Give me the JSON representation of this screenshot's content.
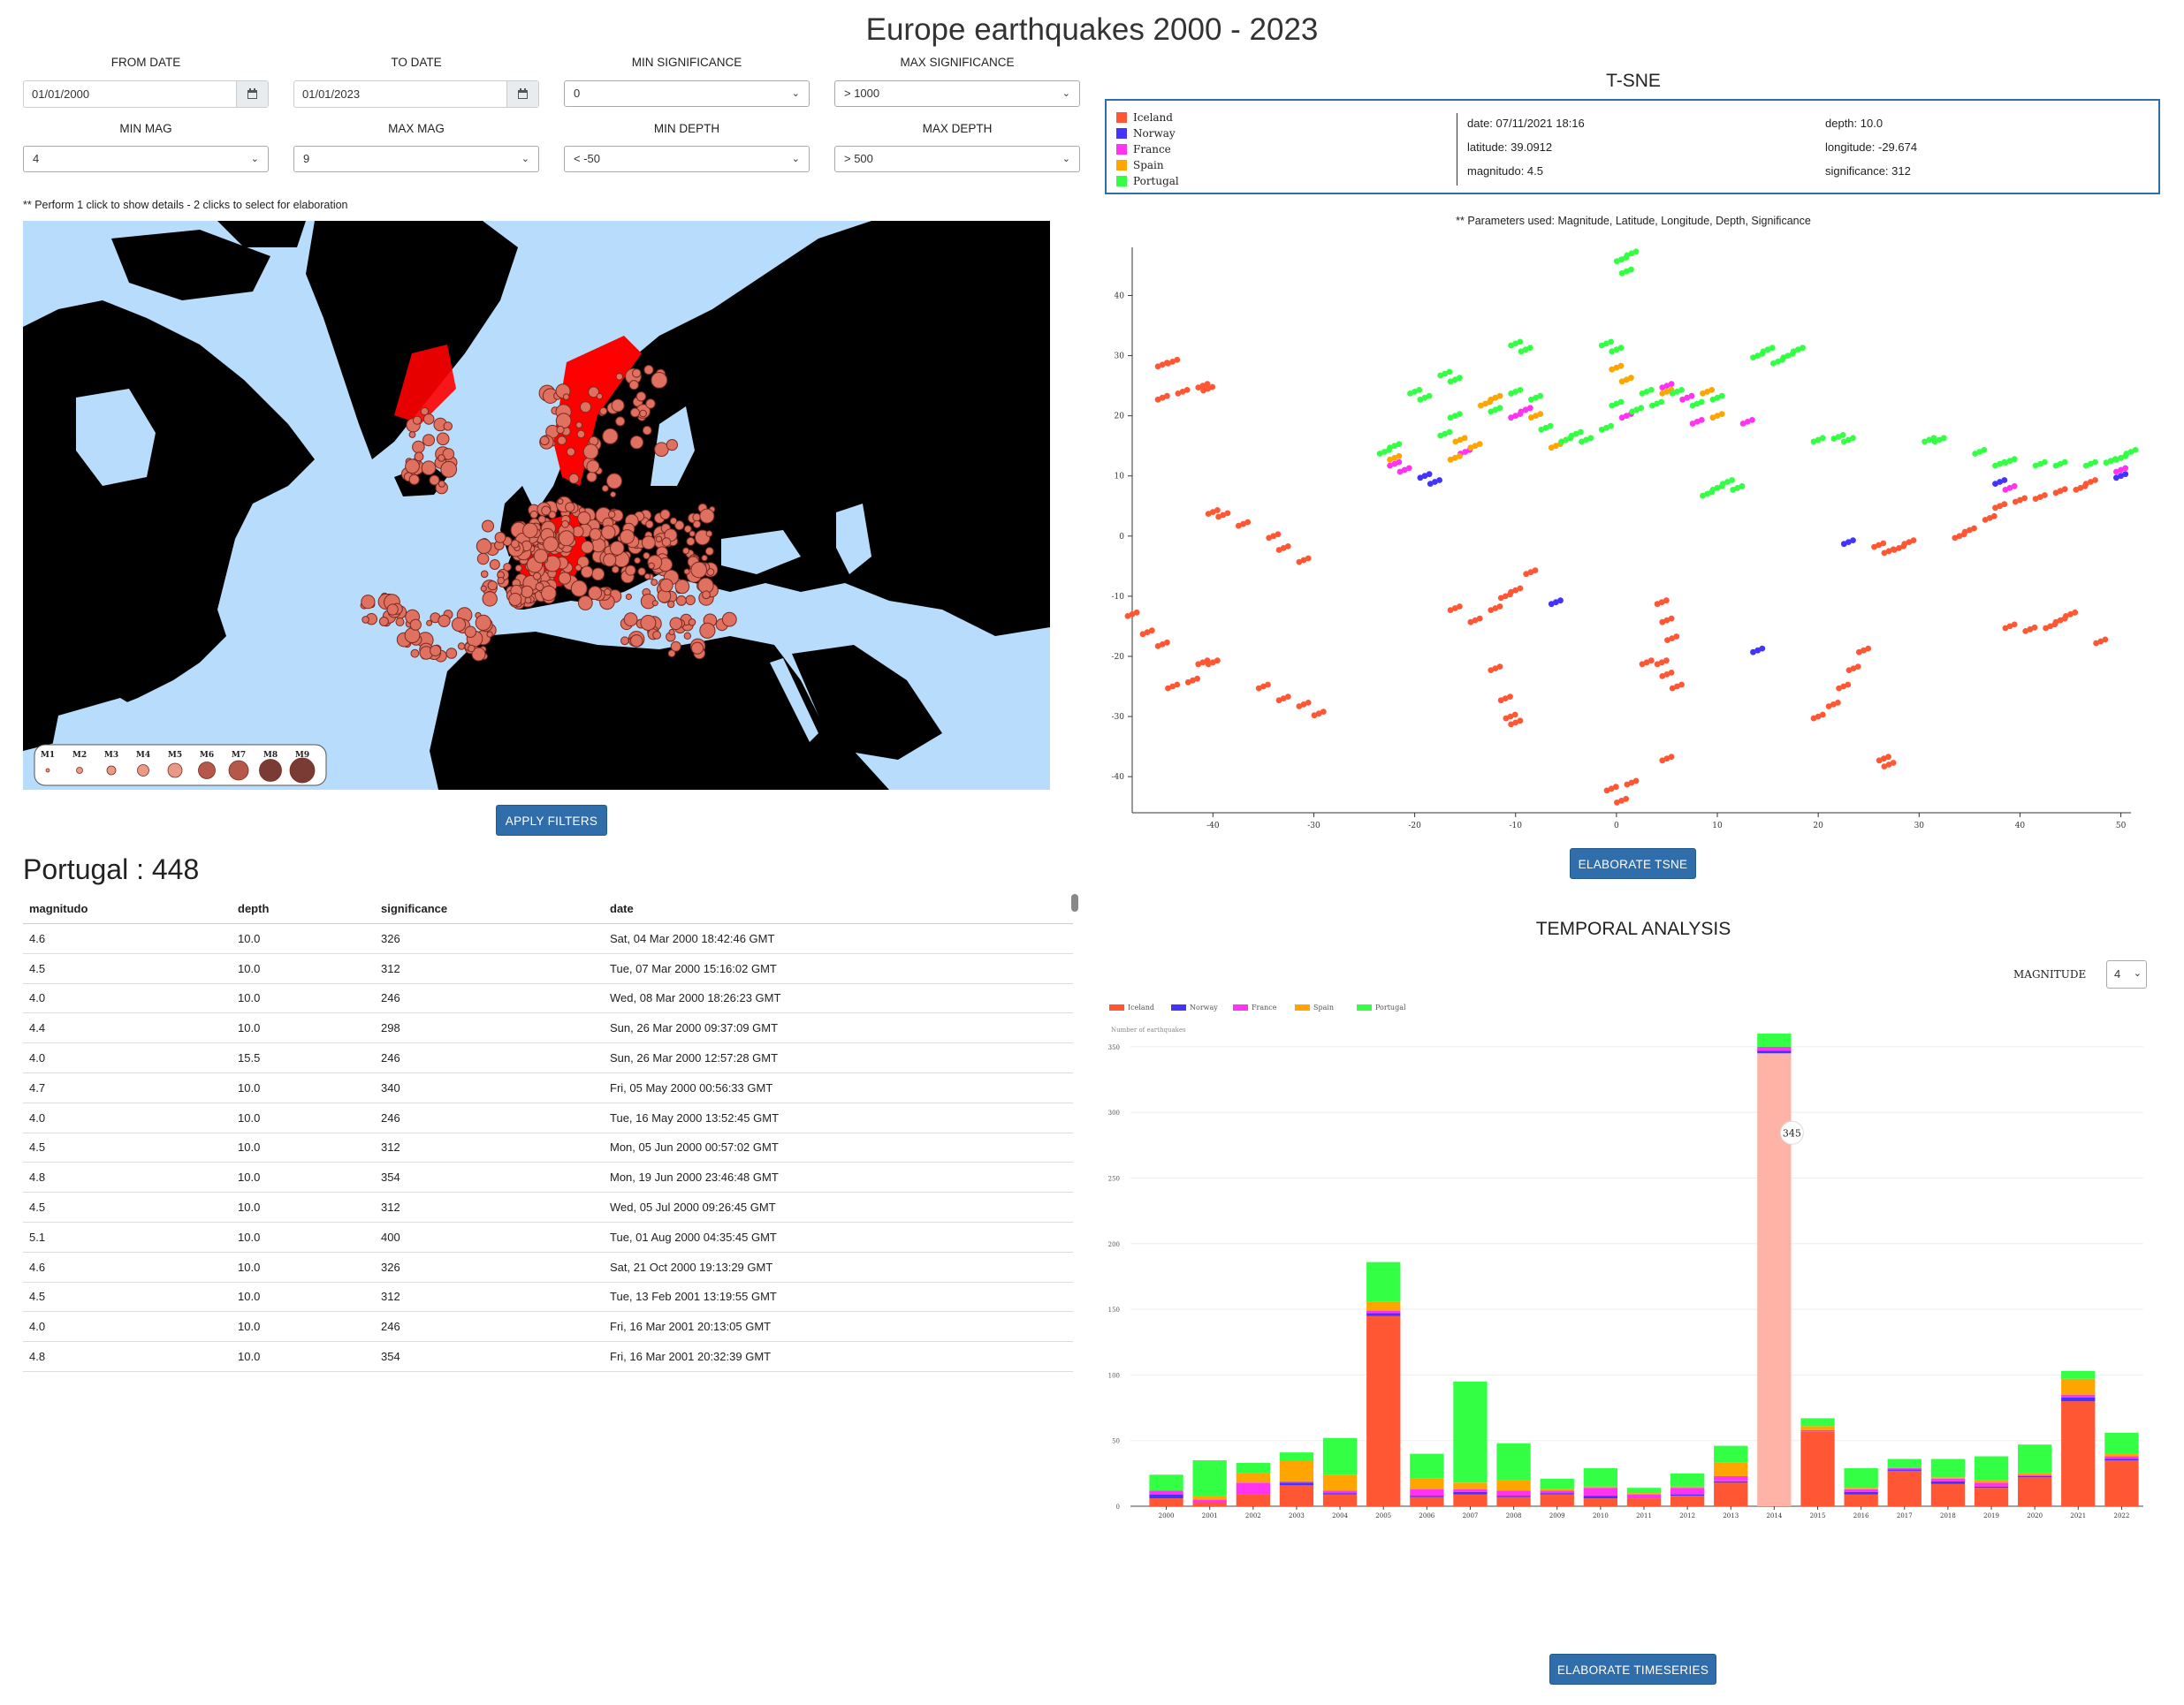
{
  "page": {
    "title": "Europe earthquakes 2000 - 2023"
  },
  "filters": {
    "from_date": {
      "label": "FROM DATE",
      "value": "01/01/2000"
    },
    "to_date": {
      "label": "TO DATE",
      "value": "01/01/2023"
    },
    "min_significance": {
      "label": "MIN SIGNIFICANCE",
      "value": "0"
    },
    "max_significance": {
      "label": "MAX SIGNIFICANCE",
      "value": "> 1000"
    },
    "min_mag": {
      "label": "MIN MAG",
      "value": "4"
    },
    "max_mag": {
      "label": "MAX MAG",
      "value": "9"
    },
    "min_depth": {
      "label": "MIN DEPTH",
      "value": "< -50"
    },
    "max_depth": {
      "label": "MAX DEPTH",
      "value": "> 500"
    }
  },
  "map": {
    "hint": "** Perform 1 click to show details - 2 clicks to select for elaboration",
    "legend": [
      "M1",
      "M2",
      "M3",
      "M4",
      "M5",
      "M6",
      "M7",
      "M8",
      "M9"
    ],
    "colors": {
      "sea": "#b8dcfb",
      "land": "#000000",
      "quake": "#e07060",
      "selected": "#ff0000"
    }
  },
  "apply_button": "APPLY FILTERS",
  "table": {
    "title": "Portugal : 448",
    "columns": [
      "magnitudo",
      "depth",
      "significance",
      "date"
    ],
    "rows": [
      [
        "4.6",
        "10.0",
        "326",
        "Sat, 04 Mar 2000 18:42:46 GMT"
      ],
      [
        "4.5",
        "10.0",
        "312",
        "Tue, 07 Mar 2000 15:16:02 GMT"
      ],
      [
        "4.0",
        "10.0",
        "246",
        "Wed, 08 Mar 2000 18:26:23 GMT"
      ],
      [
        "4.4",
        "10.0",
        "298",
        "Sun, 26 Mar 2000 09:37:09 GMT"
      ],
      [
        "4.0",
        "15.5",
        "246",
        "Sun, 26 Mar 2000 12:57:28 GMT"
      ],
      [
        "4.7",
        "10.0",
        "340",
        "Fri, 05 May 2000 00:56:33 GMT"
      ],
      [
        "4.0",
        "10.0",
        "246",
        "Tue, 16 May 2000 13:52:45 GMT"
      ],
      [
        "4.5",
        "10.0",
        "312",
        "Mon, 05 Jun 2000 00:57:02 GMT"
      ],
      [
        "4.8",
        "10.0",
        "354",
        "Mon, 19 Jun 2000 23:46:48 GMT"
      ],
      [
        "4.5",
        "10.0",
        "312",
        "Wed, 05 Jul 2000 09:26:45 GMT"
      ],
      [
        "5.1",
        "10.0",
        "400",
        "Tue, 01 Aug 2000 04:35:45 GMT"
      ],
      [
        "4.6",
        "10.0",
        "326",
        "Sat, 21 Oct 2000 19:13:29 GMT"
      ],
      [
        "4.5",
        "10.0",
        "312",
        "Tue, 13 Feb 2001 13:19:55 GMT"
      ],
      [
        "4.0",
        "10.0",
        "246",
        "Fri, 16 Mar 2001 20:13:05 GMT"
      ],
      [
        "4.8",
        "10.0",
        "354",
        "Fri, 16 Mar 2001 20:32:39 GMT"
      ]
    ]
  },
  "tsne": {
    "title": "T-SNE",
    "legend": [
      {
        "name": "Iceland",
        "color": "#ff5733"
      },
      {
        "name": "Norway",
        "color": "#4433ff"
      },
      {
        "name": "France",
        "color": "#ff33f0"
      },
      {
        "name": "Spain",
        "color": "#ffa500"
      },
      {
        "name": "Portugal",
        "color": "#33ff44"
      }
    ],
    "details": {
      "date": "date: 07/11/2021 18:16",
      "depth": "depth: 10.0",
      "latitude": "latitude: 39.0912",
      "longitude": "longitude: -29.674",
      "magnitudo": "magnitudo: 4.5",
      "significance": "significance: 312"
    },
    "note": "** Parameters used: Magnitude, Latitude, Longitude, Depth, Significance",
    "button": "ELABORATE TSNE"
  },
  "chart_data": [
    {
      "type": "scatter",
      "title": "T-SNE",
      "xlim": [
        -48,
        51
      ],
      "ylim": [
        -46,
        48
      ],
      "xticks": [
        -40,
        -30,
        -20,
        -10,
        0,
        10,
        20,
        30,
        40,
        50
      ],
      "yticks": [
        -40,
        -30,
        -20,
        -10,
        0,
        10,
        20,
        30,
        40
      ],
      "series": [
        {
          "name": "Iceland",
          "color": "#ff5733",
          "points": [
            [
              -45,
              28.5
            ],
            [
              -44,
              29
            ],
            [
              -45,
              23
            ],
            [
              -43,
              24
            ],
            [
              -41,
              25
            ],
            [
              -40.5,
              24.5
            ],
            [
              -40,
              4
            ],
            [
              -39,
              3.5
            ],
            [
              -37,
              2
            ],
            [
              -34,
              0
            ],
            [
              -33,
              -2
            ],
            [
              -31,
              -4
            ],
            [
              -48,
              -13
            ],
            [
              -46.5,
              -16
            ],
            [
              -45,
              -18
            ],
            [
              -44,
              -25
            ],
            [
              -42,
              -24
            ],
            [
              -41,
              -21
            ],
            [
              -40,
              -21
            ],
            [
              -35,
              -25
            ],
            [
              -33,
              -27
            ],
            [
              -31,
              -28
            ],
            [
              -29.5,
              -29.5
            ],
            [
              -16,
              -12
            ],
            [
              -14,
              -14
            ],
            [
              -12,
              -12
            ],
            [
              -11,
              -10
            ],
            [
              -10,
              -9
            ],
            [
              -8.5,
              -6
            ],
            [
              -12,
              -22
            ],
            [
              -11,
              -27
            ],
            [
              -10.5,
              -30
            ],
            [
              -10,
              -31
            ],
            [
              -0.5,
              -42
            ],
            [
              0.5,
              -44
            ],
            [
              1.5,
              -41
            ],
            [
              5,
              -37
            ],
            [
              4.5,
              -11
            ],
            [
              5,
              -14
            ],
            [
              5.5,
              -17
            ],
            [
              4.5,
              -21
            ],
            [
              5,
              -23
            ],
            [
              6,
              -25
            ],
            [
              3,
              -21
            ],
            [
              20,
              -30
            ],
            [
              21.5,
              -28
            ],
            [
              22.5,
              -25
            ],
            [
              23.5,
              -22
            ],
            [
              24.5,
              -19
            ],
            [
              26.5,
              -37
            ],
            [
              27,
              -38
            ],
            [
              26,
              -1.5
            ],
            [
              27,
              -2.5
            ],
            [
              28,
              -2
            ],
            [
              29,
              -1
            ],
            [
              34,
              0
            ],
            [
              35,
              1
            ],
            [
              37,
              3
            ],
            [
              38,
              5
            ],
            [
              40,
              6
            ],
            [
              42,
              6.5
            ],
            [
              44,
              7.5
            ],
            [
              46,
              8
            ],
            [
              47,
              9
            ],
            [
              39,
              -15
            ],
            [
              41,
              -15.5
            ],
            [
              43,
              -15
            ],
            [
              44,
              -14
            ],
            [
              45,
              -13
            ],
            [
              48,
              -17.5
            ]
          ]
        },
        {
          "name": "Norway",
          "color": "#4433ff",
          "points": [
            [
              -19,
              10
            ],
            [
              -18,
              9
            ],
            [
              -6,
              -11
            ],
            [
              14,
              -19
            ],
            [
              23,
              -1
            ],
            [
              38,
              9
            ],
            [
              50,
              10
            ]
          ]
        },
        {
          "name": "France",
          "color": "#ff33f0",
          "points": [
            [
              -22,
              12
            ],
            [
              -21,
              11
            ],
            [
              -15,
              14
            ],
            [
              -10,
              20
            ],
            [
              -9,
              21
            ],
            [
              1,
              20
            ],
            [
              5,
              25
            ],
            [
              7,
              23
            ],
            [
              8,
              19
            ],
            [
              13,
              19
            ],
            [
              39,
              8
            ],
            [
              50,
              11
            ]
          ]
        },
        {
          "name": "Spain",
          "color": "#ffa500",
          "points": [
            [
              -22,
              13
            ],
            [
              -16,
              13
            ],
            [
              -15.5,
              16
            ],
            [
              -14,
              15
            ],
            [
              -13,
              22
            ],
            [
              -12,
              23
            ],
            [
              -8,
              20
            ],
            [
              -6,
              15
            ],
            [
              -5,
              16
            ],
            [
              0,
              28
            ],
            [
              1,
              26
            ],
            [
              5,
              24
            ],
            [
              9,
              24
            ],
            [
              10,
              20
            ]
          ]
        },
        {
          "name": "Portugal",
          "color": "#33ff44",
          "points": [
            [
              0.5,
              46
            ],
            [
              1.5,
              47
            ],
            [
              1,
              44
            ],
            [
              -10,
              32
            ],
            [
              -9,
              31
            ],
            [
              -1,
              32
            ],
            [
              0,
              31
            ],
            [
              -17,
              27
            ],
            [
              -16,
              26
            ],
            [
              -20,
              24
            ],
            [
              -19,
              23
            ],
            [
              -23,
              14
            ],
            [
              -22,
              15
            ],
            [
              -17,
              17
            ],
            [
              -16,
              20
            ],
            [
              -12,
              21
            ],
            [
              -10,
              24
            ],
            [
              -8,
              23
            ],
            [
              -7,
              18
            ],
            [
              -5,
              16
            ],
            [
              -4,
              17
            ],
            [
              -3,
              16
            ],
            [
              -1,
              18
            ],
            [
              0,
              22
            ],
            [
              2,
              21
            ],
            [
              3,
              24
            ],
            [
              4,
              22
            ],
            [
              6,
              24
            ],
            [
              8,
              22
            ],
            [
              10,
              23
            ],
            [
              14,
              30
            ],
            [
              15,
              31
            ],
            [
              16,
              29
            ],
            [
              17,
              30
            ],
            [
              18,
              31
            ],
            [
              20,
              16
            ],
            [
              22,
              16.5
            ],
            [
              23,
              16
            ],
            [
              31,
              16
            ],
            [
              32,
              16
            ],
            [
              36,
              14
            ],
            [
              38,
              12
            ],
            [
              39,
              12.5
            ],
            [
              42,
              12
            ],
            [
              44,
              12
            ],
            [
              47,
              12
            ],
            [
              49,
              12.5
            ],
            [
              50,
              13
            ],
            [
              51,
              14
            ],
            [
              9,
              7
            ],
            [
              10,
              8
            ],
            [
              11,
              9
            ],
            [
              12,
              8
            ]
          ]
        }
      ],
      "annotation": "** Parameters used: Magnitude, Latitude, Longitude, Depth, Significance"
    },
    {
      "type": "bar",
      "title": "TEMPORAL ANALYSIS",
      "ylabel": "Number of earthquakes",
      "ylim": [
        0,
        360
      ],
      "yticks": [
        0,
        50,
        100,
        150,
        200,
        250,
        300,
        350
      ],
      "categories": [
        "2000",
        "2001",
        "2002",
        "2003",
        "2004",
        "2005",
        "2006",
        "2007",
        "2008",
        "2009",
        "2010",
        "2011",
        "2012",
        "2013",
        "2014",
        "2015",
        "2016",
        "2017",
        "2018",
        "2019",
        "2020",
        "2021",
        "2022"
      ],
      "series": [
        {
          "name": "Iceland",
          "color": "#ff5733",
          "values": [
            6,
            3,
            9,
            16,
            9,
            145,
            7,
            9,
            7,
            9,
            6,
            6,
            8,
            18,
            345,
            57,
            9,
            27,
            17,
            14,
            22,
            80,
            35
          ]
        },
        {
          "name": "Norway",
          "color": "#4433ff",
          "values": [
            3,
            0,
            0,
            2,
            1,
            2,
            1,
            2,
            1,
            1,
            2,
            0,
            1,
            1,
            2,
            0,
            2,
            1,
            2,
            1,
            1,
            3,
            1
          ]
        },
        {
          "name": "France",
          "color": "#ff33f0",
          "values": [
            3,
            2,
            9,
            1,
            2,
            2,
            5,
            2,
            4,
            2,
            6,
            3,
            5,
            4,
            3,
            1,
            2,
            1,
            2,
            3,
            1,
            2,
            2
          ]
        },
        {
          "name": "Spain",
          "color": "#ffa500",
          "values": [
            0,
            3,
            7,
            16,
            12,
            7,
            8,
            5,
            8,
            1,
            1,
            1,
            1,
            10,
            0,
            3,
            1,
            0,
            1,
            2,
            1,
            12,
            2
          ]
        },
        {
          "name": "Portugal",
          "color": "#33ff44",
          "values": [
            12,
            27,
            8,
            6,
            28,
            30,
            19,
            77,
            28,
            8,
            14,
            4,
            10,
            13,
            10,
            6,
            15,
            7,
            14,
            18,
            22,
            6,
            16
          ]
        }
      ],
      "highlight": {
        "category": "2014",
        "label": "345"
      }
    }
  ],
  "temporal": {
    "title": "TEMPORAL ANALYSIS",
    "selector_label": "MAGNITUDE",
    "selector_value": "4",
    "ylabel": "Number of earthquakes",
    "button": "ELABORATE TIMESERIES"
  }
}
